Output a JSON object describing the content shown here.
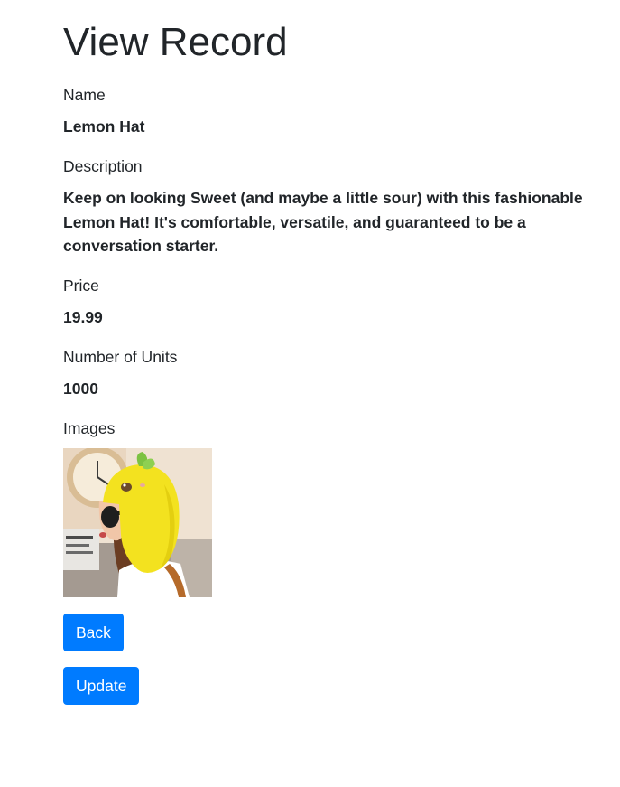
{
  "page": {
    "title": "View Record"
  },
  "record": {
    "name_label": "Name",
    "name_value": "Lemon Hat",
    "description_label": "Description",
    "description_value": "Keep on looking Sweet (and maybe a little sour) with this fashionable Lemon Hat! It's comfortable, versatile, and guaranteed to be a conversation starter.",
    "price_label": "Price",
    "price_value": "19.99",
    "units_label": "Number of Units",
    "units_value": "1000",
    "images_label": "Images"
  },
  "actions": {
    "back_label": "Back",
    "update_label": "Update"
  },
  "colors": {
    "primary_button": "#007bff",
    "text": "#212529",
    "hat_yellow": "#f3e21f",
    "leaf_green": "#7cc242"
  },
  "icons": {
    "image": "lemon-hat-product-photo"
  }
}
